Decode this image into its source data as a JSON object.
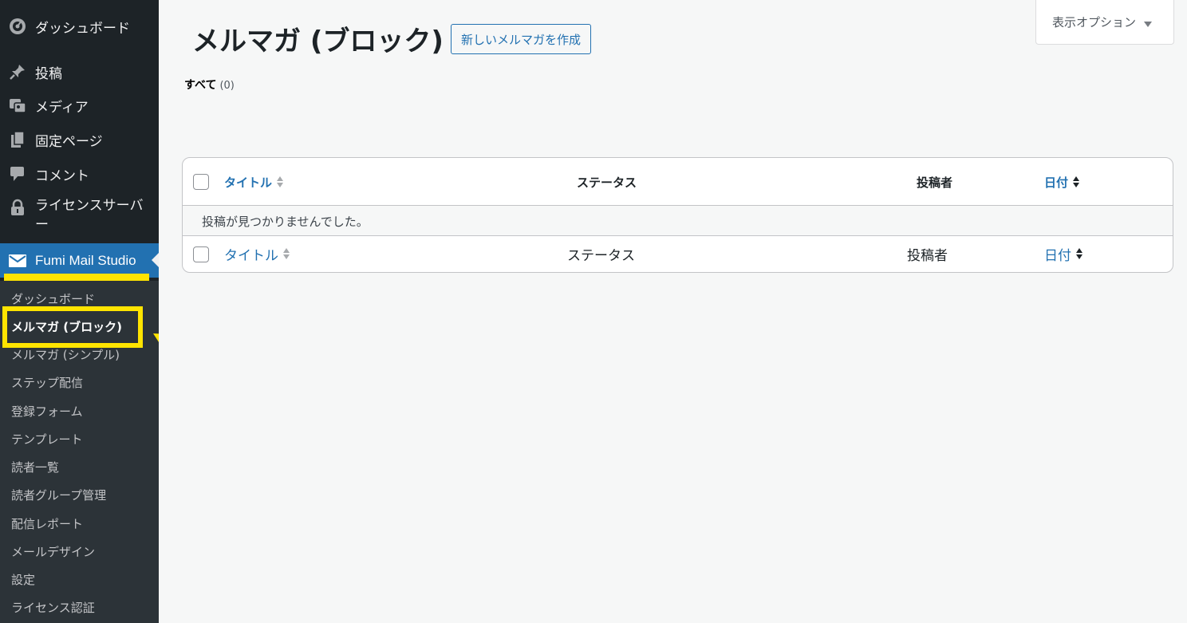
{
  "sidebar": {
    "menu": [
      {
        "label": "ダッシュボード",
        "icon": "dashboard-icon"
      },
      {
        "label": "投稿",
        "icon": "pin-icon"
      },
      {
        "label": "メディア",
        "icon": "media-icon"
      },
      {
        "label": "固定ページ",
        "icon": "page-icon"
      },
      {
        "label": "コメント",
        "icon": "comment-icon"
      },
      {
        "label": "ライセンスサーバー",
        "icon": "lock-icon"
      }
    ],
    "active_plugin": {
      "label": "Fumi Mail Studio",
      "icon": "envelope-icon"
    },
    "submenu": [
      {
        "label": "ダッシュボード"
      },
      {
        "label": "メルマガ (ブロック)",
        "current": true
      },
      {
        "label": "メルマガ (シンプル)"
      },
      {
        "label": "ステップ配信"
      },
      {
        "label": "登録フォーム"
      },
      {
        "label": "テンプレート"
      },
      {
        "label": "読者一覧"
      },
      {
        "label": "読者グループ管理"
      },
      {
        "label": "配信レポート"
      },
      {
        "label": "メールデザイン"
      },
      {
        "label": "設定"
      },
      {
        "label": "ライセンス認証"
      }
    ]
  },
  "header": {
    "title": "メルマガ (ブロック)",
    "add_new_label": "新しいメルマガを作成",
    "screen_options_label": "表示オプション"
  },
  "filters": {
    "all_label": "すべて",
    "all_count": "(0)"
  },
  "table": {
    "columns": {
      "title": "タイトル",
      "status": "ステータス",
      "author": "投稿者",
      "date": "日付"
    },
    "empty_message": "投稿が見つかりませんでした。"
  },
  "colors": {
    "sidebar_bg": "#1d2327",
    "submenu_bg": "#2c3338",
    "accent": "#2271b1",
    "highlight": "#ffe400"
  }
}
